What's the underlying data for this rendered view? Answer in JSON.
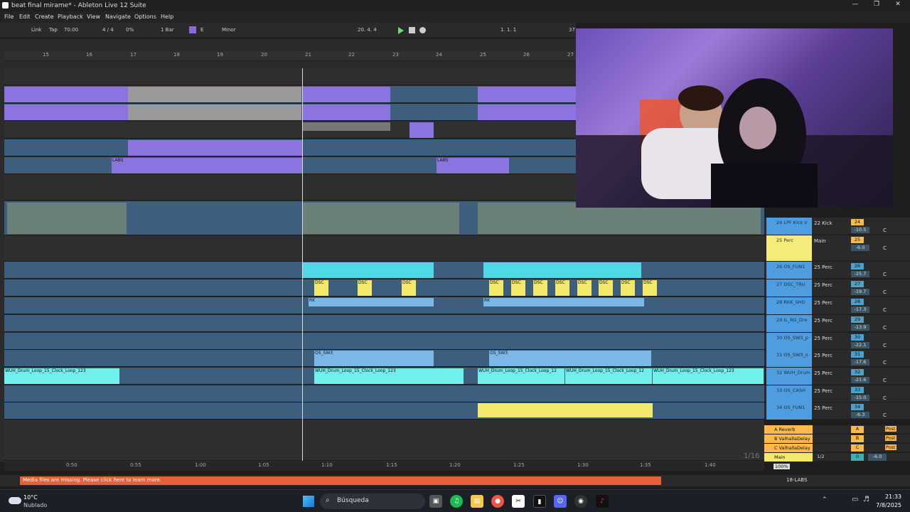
{
  "window": {
    "title": "beat final mirame* - Ableton Live 12 Suite",
    "minimize": "—",
    "restore": "❐",
    "close": "✕"
  },
  "menu": [
    "File",
    "Edit",
    "Create",
    "Playback",
    "View",
    "Navigate",
    "Options",
    "Help"
  ],
  "control": {
    "link": "Link",
    "tap": "Tap",
    "tempo": "70.00",
    "sig": "4 / 4",
    "cpu_pct": "0%",
    "quant": "1 Bar",
    "key": "E",
    "scale": "Minor",
    "position": "20.  4.  4",
    "loop_start": "1.  1.  1",
    "loop_len": "37"
  },
  "ruler": [
    "15",
    "16",
    "17",
    "18",
    "19",
    "20",
    "21",
    "22",
    "23",
    "24",
    "25",
    "26",
    "27"
  ],
  "clips": {
    "labs": "LABS",
    "dsc": "DSC",
    "rk": "RK",
    "os_sw3": "OS_SW3",
    "os": "OS",
    "wuh": "WUH_Drum_Loop_15_Clock_Loop_123",
    "wuh_short": "WUH_Drum_Loop_15_Clock_Loop_12"
  },
  "tracks": [
    {
      "name": "24 LPF Kick V",
      "route": "22 Kick",
      "num": "24",
      "vol": "-10.5",
      "pan": "C",
      "color": "#4d9de0"
    },
    {
      "name": "25 Perc",
      "route": "Main",
      "num": "25",
      "vol": "-6.0",
      "pan": "C",
      "color": "#f3ec7a"
    },
    {
      "name": "26 OS_FUN1",
      "route": "25 Perc",
      "num": "26",
      "vol": "-25.7",
      "pan": "C",
      "color": "#4d9de0"
    },
    {
      "name": "27 DSC_TRU",
      "route": "25 Perc",
      "num": "27",
      "vol": "-19.7",
      "pan": "C",
      "color": "#4d9de0"
    },
    {
      "name": "28 RKK_SHO",
      "route": "25 Perc",
      "num": "28",
      "vol": "-17.3",
      "pan": "C",
      "color": "#4d9de0"
    },
    {
      "name": "29 IL_RG_Dre",
      "route": "25 Perc",
      "num": "29",
      "vol": "-13.9",
      "pan": "C",
      "color": "#4d9de0"
    },
    {
      "name": "30 OS_SW3_p",
      "route": "25 Perc",
      "num": "30",
      "vol": "-22.1",
      "pan": "C",
      "color": "#4d9de0"
    },
    {
      "name": "31 OS_SW3_o",
      "route": "25 Perc",
      "num": "31",
      "vol": "-17.6",
      "pan": "C",
      "color": "#4d9de0"
    },
    {
      "name": "32 WUH_Drum",
      "route": "25 Perc",
      "num": "32",
      "vol": "-21.6",
      "pan": "C",
      "color": "#4d9de0"
    },
    {
      "name": "33 OS_CASH",
      "route": "25 Perc",
      "num": "33",
      "vol": "-15.0",
      "pan": "C",
      "color": "#4d9de0"
    },
    {
      "name": "34 OS_FUN1",
      "route": "25 Perc",
      "num": "34",
      "vol": "-6.3",
      "pan": "C",
      "color": "#4d9de0"
    }
  ],
  "returns": [
    {
      "name": "A Reverb",
      "letter": "A",
      "post": "Post"
    },
    {
      "name": "B ValhallaDelay",
      "letter": "B",
      "post": "Post"
    },
    {
      "name": "C ValhallaDelay",
      "letter": "C",
      "post": "Post"
    }
  ],
  "main": {
    "name": "Main",
    "route": "1/2",
    "vol": "0",
    "vol2": "-6.0"
  },
  "grid": "1/16",
  "zoom": "100%",
  "time_ruler": [
    "0:50",
    "0:55",
    "1:00",
    "1:05",
    "1:10",
    "1:15",
    "1:20",
    "1:25",
    "1:30",
    "1:35",
    "1:40"
  ],
  "status": {
    "message": "Media files are missing. Please click here to learn more.",
    "labs": "18-LABS"
  },
  "taskbar": {
    "temp": "10°C",
    "weather": "Nublado",
    "search": "Búsqueda",
    "time": "21:33",
    "date": "7/8/2025"
  }
}
